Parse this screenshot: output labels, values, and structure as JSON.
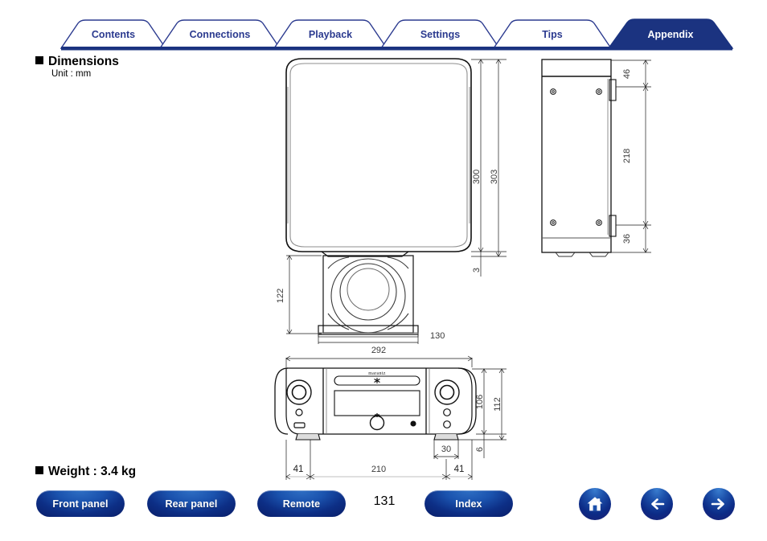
{
  "tabs": [
    {
      "label": "Contents",
      "active": false
    },
    {
      "label": "Connections",
      "active": false
    },
    {
      "label": "Playback",
      "active": false
    },
    {
      "label": "Settings",
      "active": false
    },
    {
      "label": "Tips",
      "active": false
    },
    {
      "label": "Appendix",
      "active": true
    }
  ],
  "sections": {
    "dimensions_heading": "Dimensions",
    "unit_label": "Unit : mm",
    "weight_heading": "Weight : 3.4 kg"
  },
  "drawings": {
    "front_elevation": {
      "name": "unit-front-elevation-with-stand",
      "dims": {
        "h300": "300",
        "h303": "303",
        "h3": "3",
        "h122": "122",
        "w130": "130"
      }
    },
    "side_elevation": {
      "name": "unit-side-elevation",
      "dims": {
        "h46": "46",
        "h218": "218",
        "h36": "36"
      }
    },
    "panel_front": {
      "name": "unit-front-panel",
      "brand": "marantz",
      "dims": {
        "w292": "292",
        "w41l": "41",
        "w210": "210",
        "w41r": "41",
        "w30": "30",
        "h106": "106",
        "h112": "112",
        "h6": "6"
      }
    }
  },
  "footer": {
    "buttons": [
      {
        "label": "Front panel",
        "name": "front-panel-button"
      },
      {
        "label": "Rear panel",
        "name": "rear-panel-button"
      },
      {
        "label": "Remote",
        "name": "remote-button"
      },
      {
        "label": "Index",
        "name": "index-button"
      }
    ],
    "page_number": "131",
    "icon_buttons": [
      {
        "icon": "home-icon",
        "name": "home-button"
      },
      {
        "icon": "arrow-left-icon",
        "name": "previous-page-button"
      },
      {
        "icon": "arrow-right-icon",
        "name": "next-page-button"
      }
    ]
  },
  "colors": {
    "tab_active_fill": "#1b3380",
    "tab_text": "#2b3a8f",
    "tab_border": "#2b3a8f",
    "rule": "#1b3380",
    "button_blue": "#123a96"
  }
}
